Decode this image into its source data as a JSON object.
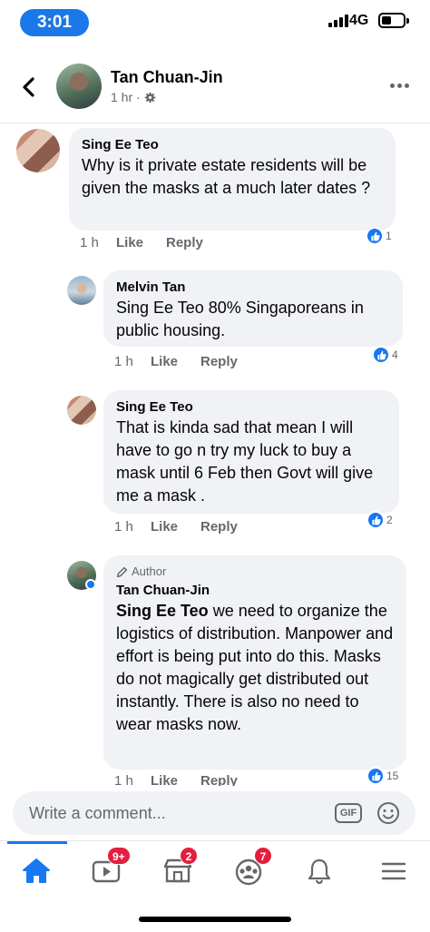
{
  "status_bar": {
    "time": "3:01",
    "network": "4G"
  },
  "header": {
    "name": "Tan Chuan-Jin",
    "meta": "1 hr ·"
  },
  "comments": [
    {
      "name": "Sing Ee Teo",
      "text": "Why is it private estate residents will be given the masks at a much later dates ?",
      "time": "1 h",
      "like": "Like",
      "reply": "Reply",
      "reactions": "1"
    },
    {
      "name": "Melvin Tan",
      "text": "Sing Ee Teo 80% Singaporeans in public housing.",
      "time": "1 h",
      "like": "Like",
      "reply": "Reply",
      "reactions": "4"
    },
    {
      "name": "Sing Ee Teo",
      "text": "That is kinda sad that mean I will have to go n try my luck to buy a mask until 6 Feb then Govt will give me a mask .",
      "time": "1 h",
      "like": "Like",
      "reply": "Reply",
      "reactions": "2"
    },
    {
      "author_tag": "Author",
      "name": "Tan Chuan-Jin",
      "mention": "Sing Ee Teo",
      "text": " we need to organize the logistics of distribution. Manpower and effort is being put into do this. Masks do not magically get distributed out instantly. There is also no need to wear masks now.",
      "time": "1 h",
      "like": "Like",
      "reply": "Reply",
      "reactions": "15"
    }
  ],
  "composer": {
    "placeholder": "Write a comment...",
    "gif": "GIF"
  },
  "nav": {
    "items": [
      {
        "icon": "home-icon",
        "badge": ""
      },
      {
        "icon": "video-icon",
        "badge": "9+"
      },
      {
        "icon": "marketplace-icon",
        "badge": "2"
      },
      {
        "icon": "groups-icon",
        "badge": "7"
      },
      {
        "icon": "bell-icon",
        "badge": ""
      },
      {
        "icon": "menu-icon",
        "badge": ""
      }
    ]
  },
  "colors": {
    "accent": "#1877f2",
    "badge": "#e41e3f",
    "bubble": "#f0f2f5",
    "time_pill": "#1a78e8"
  }
}
